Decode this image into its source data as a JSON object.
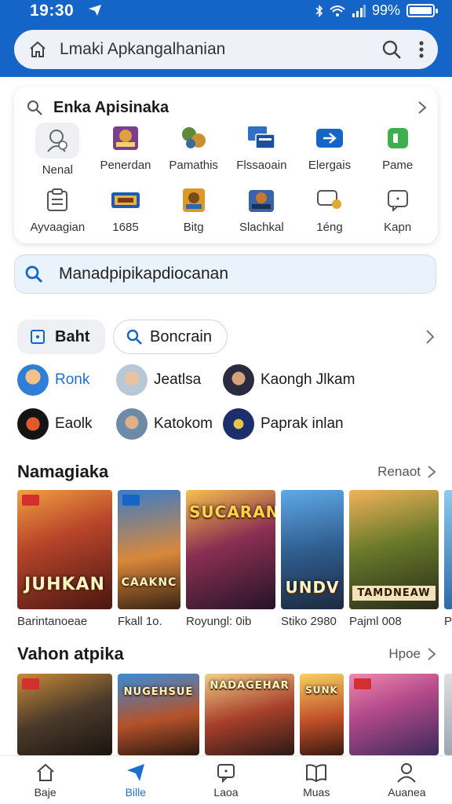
{
  "status": {
    "time": "19:30",
    "battery": "99%"
  },
  "top_search": {
    "text": "Lmaki Apkangalhanian"
  },
  "card": {
    "title": "Enka Apisinaka",
    "items": [
      {
        "label": "Nenal",
        "icon": "avatar-placeholder-icon"
      },
      {
        "label": "Penerdan",
        "icon": "game-thumb-icon"
      },
      {
        "label": "Pamathis",
        "icon": "game-thumb-icon"
      },
      {
        "label": "Flssaoain",
        "icon": "window-stack-icon"
      },
      {
        "label": "Elergais",
        "icon": "arrow-badge-icon"
      },
      {
        "label": "Pame",
        "icon": "green-app-icon"
      },
      {
        "label": "Ayvaagian",
        "icon": "clipboard-icon"
      },
      {
        "label": "1685",
        "icon": "chip-icon"
      },
      {
        "label": "Bitg",
        "icon": "game-thumb-icon"
      },
      {
        "label": "Slachkal",
        "icon": "game-thumb-icon"
      },
      {
        "label": "1éng",
        "icon": "chat-badge-icon"
      },
      {
        "label": "Kapn",
        "icon": "chat-bubble-icon"
      }
    ]
  },
  "second_search": {
    "text": "Manadpipikapdiocanan"
  },
  "chips": {
    "first": "Baht",
    "second": "Boncrain"
  },
  "friends": [
    {
      "name": "Ronk",
      "highlight": true
    },
    {
      "name": "Jeatlsa"
    },
    {
      "name": "Kaongh Jlkam"
    },
    {
      "name": "Eaolk"
    },
    {
      "name": "Katokom"
    },
    {
      "name": "Paprak inlan"
    }
  ],
  "section1": {
    "title": "Namagiaka",
    "more": "Renaot",
    "games": [
      {
        "label": "Barintanoeae",
        "art_title": "JUHKAN"
      },
      {
        "label": "Fkall 1o.",
        "art_title": "CAAKNC"
      },
      {
        "label": "Royungl: 0ib",
        "art_title": "SUCARAN"
      },
      {
        "label": "Stiko 2980",
        "art_title": "UNDV"
      },
      {
        "label": "Pajml 008",
        "art_title": "TAMDNEAW"
      },
      {
        "label": "Pi"
      }
    ]
  },
  "section2": {
    "title": "Vahon atpika",
    "more": "Hpoe",
    "games": [
      {
        "label": ""
      },
      {
        "label": "",
        "art_title": "NUGEHSUE"
      },
      {
        "label": "",
        "art_title": "NADAGEHAR"
      },
      {
        "label": "",
        "art_title": "SUNK"
      },
      {
        "label": ""
      },
      {
        "label": ""
      }
    ]
  },
  "bottom_nav": [
    {
      "label": "Baje",
      "icon": "home-icon"
    },
    {
      "label": "Bille",
      "icon": "send-icon",
      "active": true
    },
    {
      "label": "Laoa",
      "icon": "message-icon"
    },
    {
      "label": "Muas",
      "icon": "book-icon"
    },
    {
      "label": "Auanea",
      "icon": "person-icon"
    }
  ],
  "colors": {
    "brand": "#1565c9",
    "accent": "#1e6fd0"
  }
}
